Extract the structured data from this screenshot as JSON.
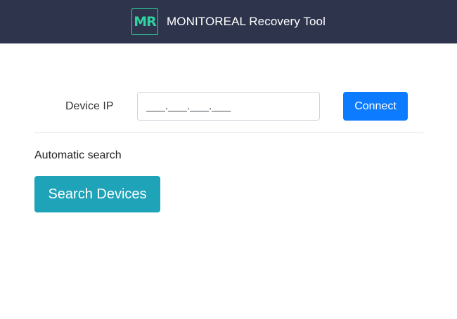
{
  "header": {
    "logo_text": "MR",
    "title": "MONITOREAL Recovery Tool"
  },
  "manual": {
    "ip_label": "Device IP",
    "ip_value": "___.___.___.___",
    "connect_label": "Connect"
  },
  "auto": {
    "label": "Automatic search",
    "search_label": "Search Devices"
  },
  "colors": {
    "header_bg": "#2e344c",
    "logo_accent": "#2fd3a0",
    "connect_bg": "#0d7bff",
    "search_bg": "#1ea3b8"
  }
}
